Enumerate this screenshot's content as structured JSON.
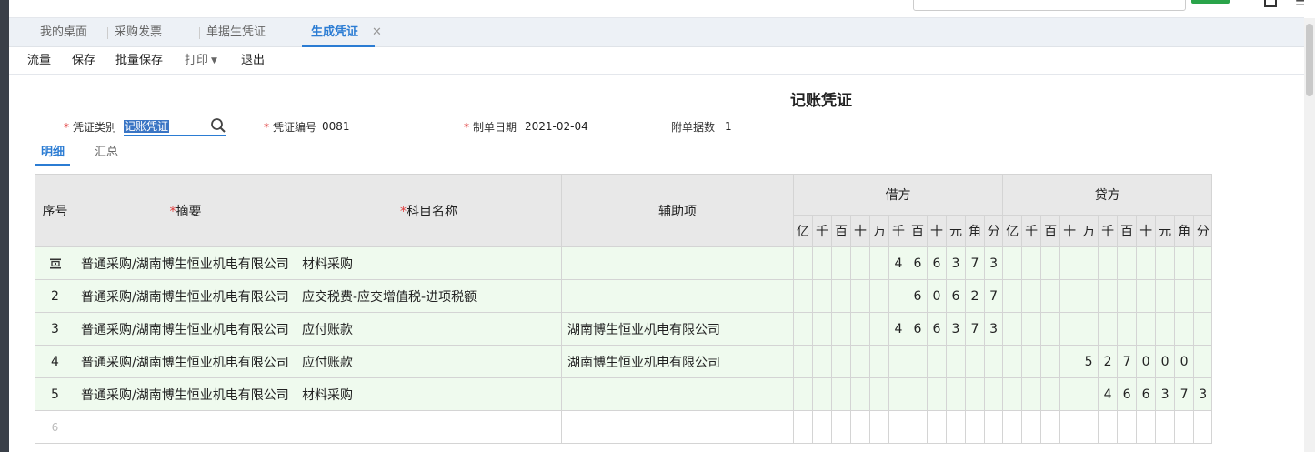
{
  "tabs": [
    {
      "label": "我的桌面"
    },
    {
      "label": "采购发票"
    },
    {
      "label": "单据生凭证"
    },
    {
      "label": "生成凭证",
      "active": true
    }
  ],
  "toolbar": {
    "flow": "流量",
    "save": "保存",
    "batch_save": "批量保存",
    "print": "打印",
    "exit": "退出"
  },
  "voucher": {
    "title": "记账凭证",
    "type_label": "凭证类别",
    "type_value": "记账凭证",
    "number_label": "凭证编号",
    "number_value": "0081",
    "date_label": "制单日期",
    "date_value": "2021-02-04",
    "attachments_label": "附单据数",
    "attachments_value": "1"
  },
  "subtabs": [
    {
      "label": "明细",
      "active": true
    },
    {
      "label": "汇总"
    }
  ],
  "grid": {
    "headers": {
      "seq": "序号",
      "summary": "摘要",
      "account": "科目名称",
      "aux": "辅助项",
      "debit": "借方",
      "credit": "贷方"
    },
    "digit_headers": [
      "亿",
      "千",
      "百",
      "十",
      "万",
      "千",
      "百",
      "十",
      "元",
      "角",
      "分"
    ],
    "rows": [
      {
        "seq": "",
        "summary": "普通采购/湖南博生恒业机电有限公司",
        "account": "材料采购",
        "aux": "",
        "debit": [
          "",
          "",
          "",
          "",
          "",
          "4",
          "6",
          "6",
          "3",
          "7",
          "3"
        ],
        "credit": [
          "",
          "",
          "",
          "",
          "",
          "",
          "",
          "",
          "",
          "",
          ""
        ]
      },
      {
        "seq": "2",
        "summary": "普通采购/湖南博生恒业机电有限公司",
        "account": "应交税费-应交增值税-进项税额",
        "aux": "",
        "debit": [
          "",
          "",
          "",
          "",
          "",
          "",
          "6",
          "0",
          "6",
          "2",
          "7"
        ],
        "credit": [
          "",
          "",
          "",
          "",
          "",
          "",
          "",
          "",
          "",
          "",
          ""
        ]
      },
      {
        "seq": "3",
        "summary": "普通采购/湖南博生恒业机电有限公司",
        "account": "应付账款",
        "aux": "湖南博生恒业机电有限公司",
        "debit": [
          "",
          "",
          "",
          "",
          "",
          "4",
          "6",
          "6",
          "3",
          "7",
          "3"
        ],
        "credit": [
          "",
          "",
          "",
          "",
          "",
          "",
          "",
          "",
          "",
          "",
          ""
        ]
      },
      {
        "seq": "4",
        "summary": "普通采购/湖南博生恒业机电有限公司",
        "account": "应付账款",
        "aux": "湖南博生恒业机电有限公司",
        "debit": [
          "",
          "",
          "",
          "",
          "",
          "",
          "",
          "",
          "",
          "",
          ""
        ],
        "credit": [
          "",
          "",
          "",
          "",
          "5",
          "2",
          "7",
          "0",
          "0",
          "0",
          ""
        ]
      },
      {
        "seq": "5",
        "summary": "普通采购/湖南博生恒业机电有限公司",
        "account": "材料采购",
        "aux": "",
        "debit": [
          "",
          "",
          "",
          "",
          "",
          "",
          "",
          "",
          "",
          "",
          ""
        ],
        "credit": [
          "",
          "",
          "",
          "",
          "",
          "4",
          "6",
          "6",
          "3",
          "7",
          "3"
        ]
      }
    ],
    "blank_row_seq": "6"
  },
  "colors": {
    "accent": "#2b7cd3",
    "row_bg": "#effaee",
    "required": "#e03c3c"
  }
}
